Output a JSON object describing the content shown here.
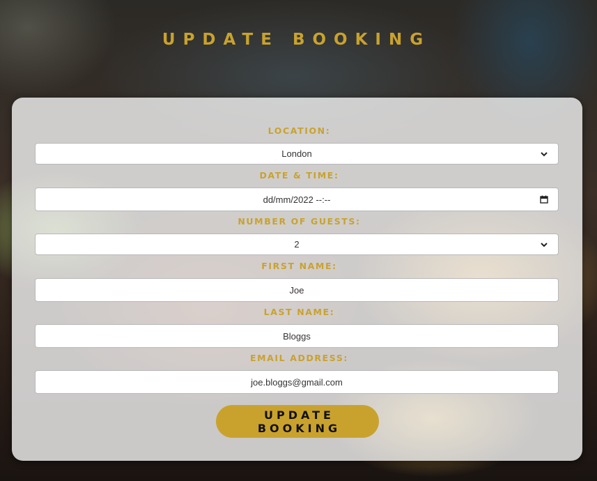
{
  "page": {
    "title": "UPDATE BOOKING",
    "accent_color": "#c9a22e"
  },
  "form": {
    "location": {
      "label": "LOCATION:",
      "value": "London",
      "icon": "chevron-down-icon"
    },
    "datetime": {
      "label": "DATE & TIME:",
      "value": "dd/mm/2022 --:--",
      "icon": "calendar-icon"
    },
    "guests": {
      "label": "NUMBER OF GUESTS:",
      "value": "2",
      "icon": "chevron-down-icon"
    },
    "first_name": {
      "label": "FIRST NAME:",
      "value": "Joe"
    },
    "last_name": {
      "label": "LAST NAME:",
      "value": "Bloggs"
    },
    "email": {
      "label": "EMAIL ADDRESS:",
      "value": "joe.bloggs@gmail.com"
    },
    "submit_label": "UPDATE BOOKING"
  }
}
